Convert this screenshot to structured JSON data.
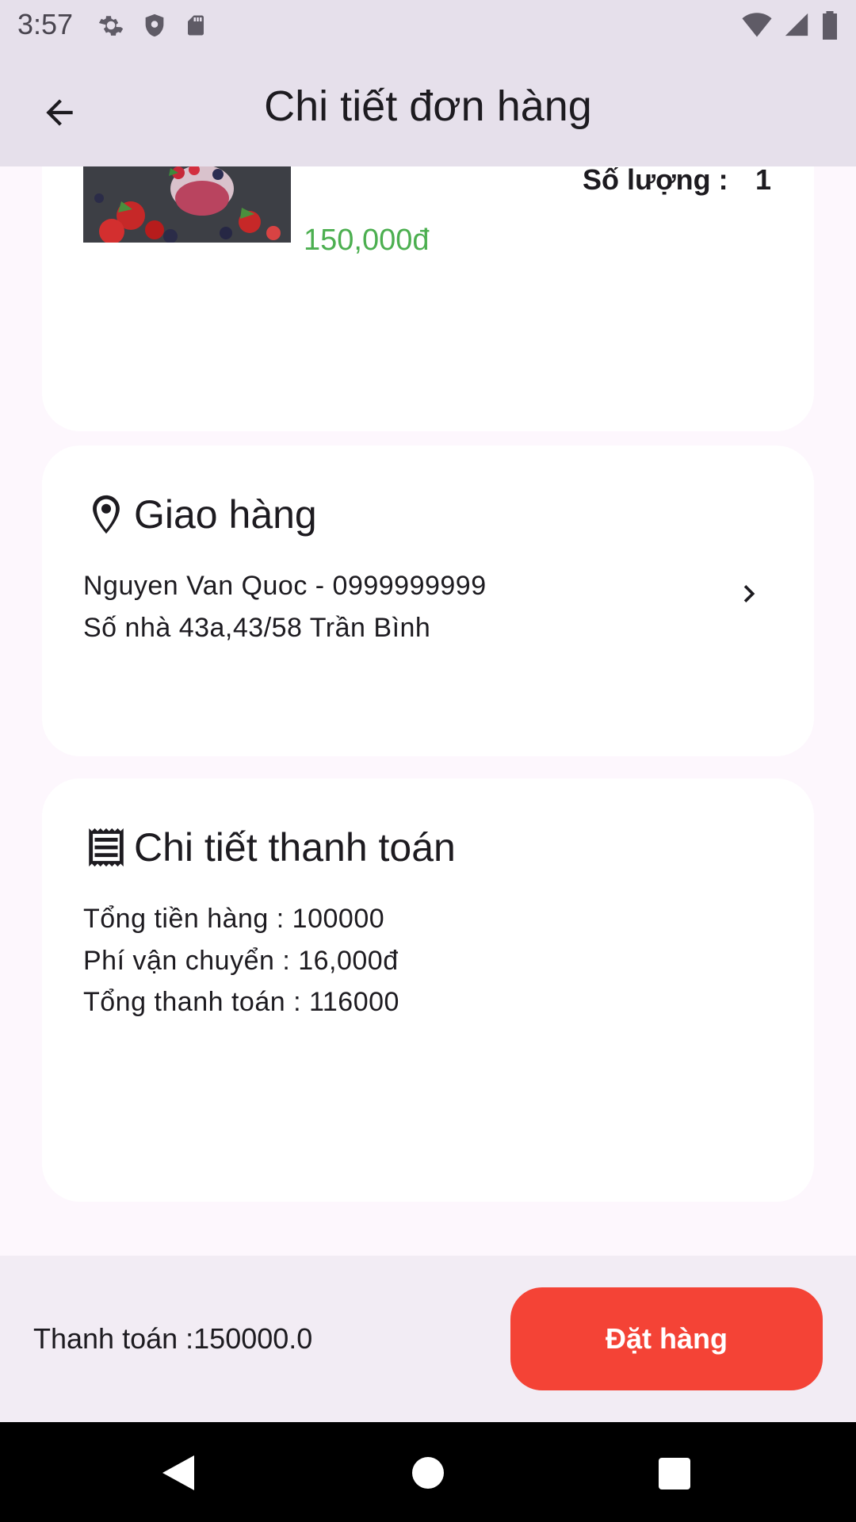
{
  "status_bar": {
    "time": "3:57",
    "icons_left": [
      "gear-icon",
      "shield-icon",
      "sd-card-icon"
    ],
    "icons_right": [
      "wifi-icon",
      "signal-icon",
      "battery-icon"
    ]
  },
  "app_bar": {
    "title": "Chi tiết đơn hàng",
    "back_icon": "arrow-back-icon"
  },
  "product": {
    "price": "150,000đ",
    "quantity_label": "Số lượng :",
    "quantity_value": "1",
    "price_color": "#4caf50"
  },
  "shipping": {
    "title": "Giao hàng",
    "icon": "location-pin-icon",
    "recipient": "Nguyen Van Quoc - 0999999999",
    "address": "Số nhà 43a,43/58 Trần Bình"
  },
  "payment_details": {
    "title": "Chi tiết thanh toán",
    "icon": "receipt-icon",
    "subtotal": "Tổng tiền hàng : 100000",
    "shipping_fee": "Phí vận chuyển : 16,000đ",
    "total": "Tổng thanh toán : 116000"
  },
  "bottom": {
    "total_text": "Thanh toán :150000.0",
    "order_button": "Đặt hàng",
    "button_color": "#f44336"
  },
  "nav": {
    "back": "nav-back-icon",
    "home": "nav-home-icon",
    "recent": "nav-recents-icon"
  }
}
